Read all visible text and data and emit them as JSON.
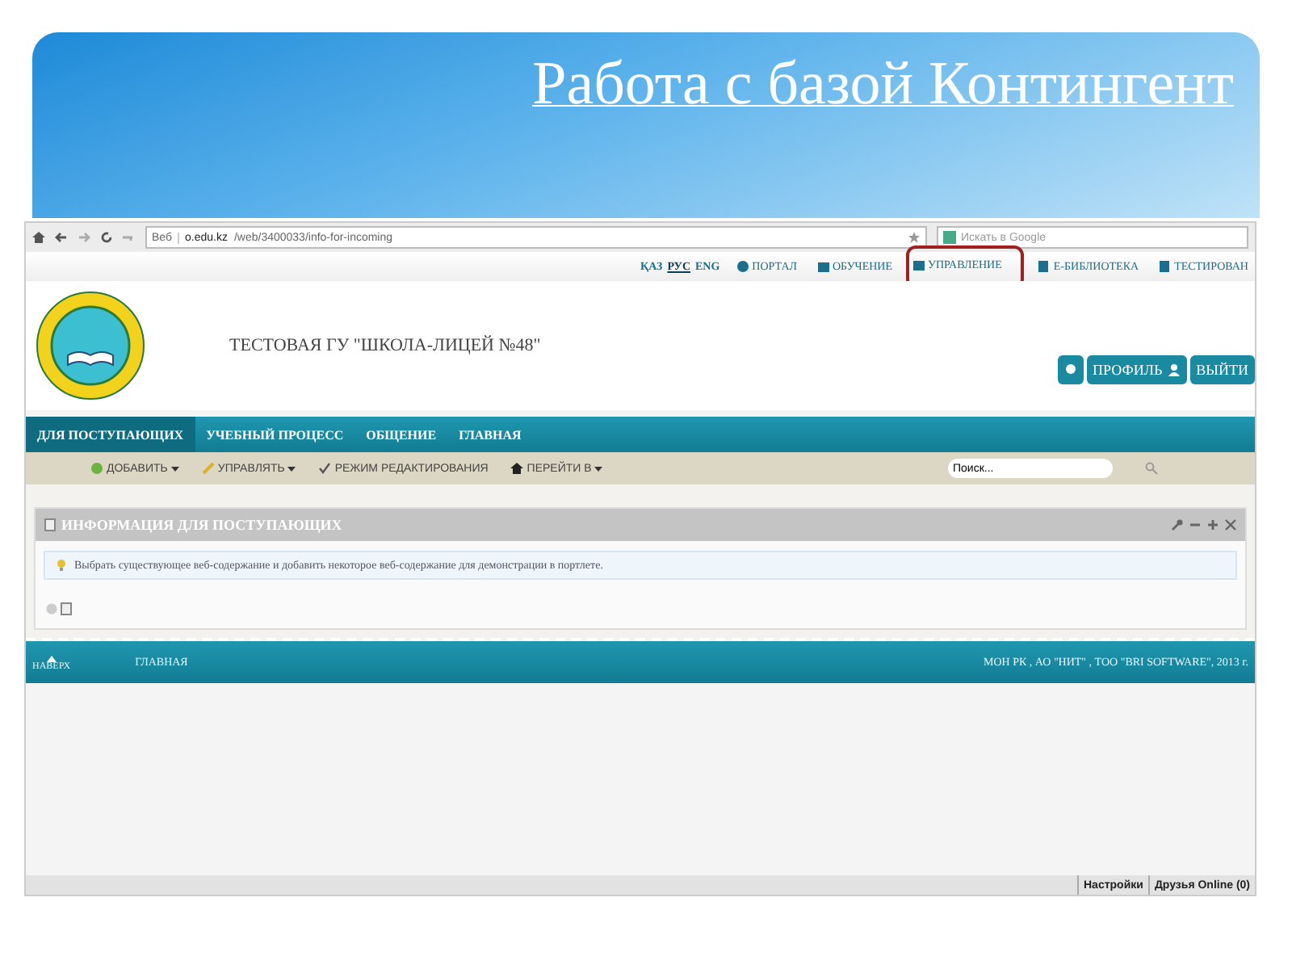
{
  "slide": {
    "title": "Работа с базой Контингент"
  },
  "browser": {
    "site_label": "Веб",
    "url_host": "o.edu.kz",
    "url_path": "/web/3400033/info-for-incoming",
    "search_placeholder": "Искать в Google"
  },
  "languages": [
    {
      "label": "ҚАЗ",
      "selected": false
    },
    {
      "label": "РУС",
      "selected": true
    },
    {
      "label": "ENG",
      "selected": false
    }
  ],
  "top_links": [
    {
      "label": "ПОРТАЛ",
      "kind": "globe",
      "highlighted": false
    },
    {
      "label": "ОБУЧЕНИЕ",
      "kind": "folder",
      "highlighted": false
    },
    {
      "label": "УПРАВЛЕНИЕ",
      "kind": "folder",
      "highlighted": true
    },
    {
      "label": "E-БИБЛИОТЕКА",
      "kind": "book",
      "highlighted": false
    },
    {
      "label": "ТЕСТИРОВАН",
      "kind": "book",
      "highlighted": false
    }
  ],
  "school_name": "ТЕСТОВАЯ ГУ \"ШКОЛА-ЛИЦЕЙ №48\"",
  "user_buttons": [
    {
      "label": "ПРОФИЛЬ",
      "kind": "profile"
    },
    {
      "label": "ВЫЙТИ",
      "kind": "logout"
    }
  ],
  "nav_tabs": [
    {
      "label": "ДЛЯ ПОСТУПАЮЩИХ",
      "selected": true
    },
    {
      "label": "УЧЕБНЫЙ ПРОЦЕСС",
      "selected": false
    },
    {
      "label": "ОБЩЕНИЕ",
      "selected": false
    },
    {
      "label": "ГЛАВНАЯ",
      "selected": false
    }
  ],
  "toolbar": [
    {
      "label": "ДОБАВИТЬ",
      "kind": "add"
    },
    {
      "label": "УПРАВЛЯТЬ",
      "kind": "manage"
    },
    {
      "label": "РЕЖИМ РЕДАКТИРОВАНИЯ",
      "kind": "check"
    },
    {
      "label": "ПЕРЕЙТИ В",
      "kind": "home"
    }
  ],
  "search": {
    "value": "Поиск..."
  },
  "portlet": {
    "title": "ИНФОРМАЦИЯ ДЛЯ ПОСТУПАЮЩИХ",
    "message": "Выбрать существующее веб-содержание и добавить некоторое веб-содержание для демонстрации в портлете."
  },
  "footer": {
    "top_link": "НАВЕРХ",
    "home_link": "ГЛАВНАЯ",
    "copyright": "МОН РК , АО \"НИТ\" , ТОО \"BRI SOFTWARE\", 2013 г."
  },
  "status_bar": {
    "items": [
      "Настройки",
      "Друзья Online (0)"
    ]
  }
}
